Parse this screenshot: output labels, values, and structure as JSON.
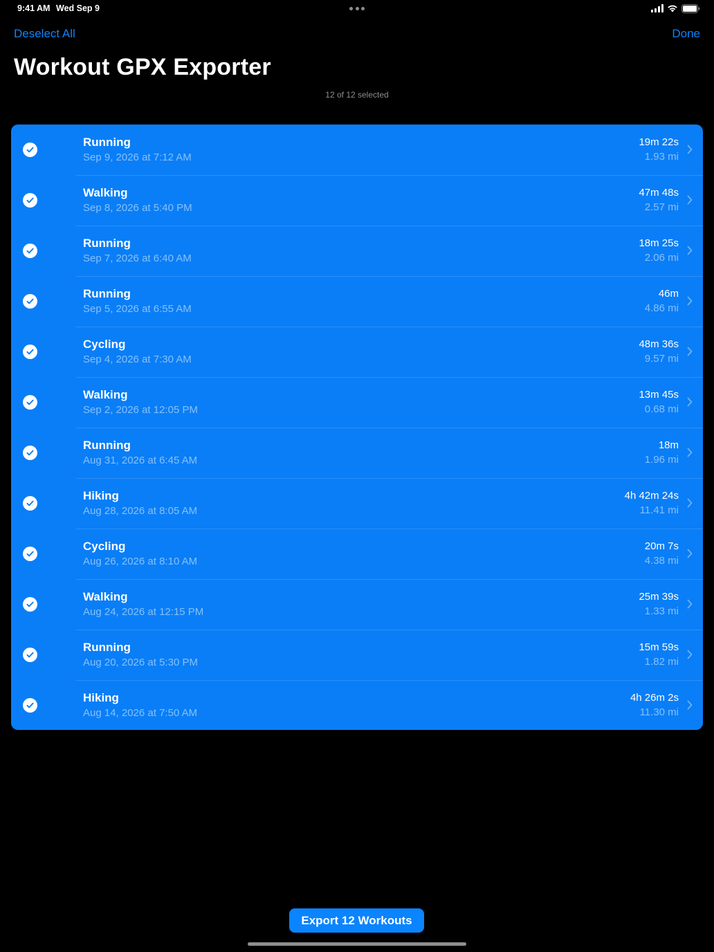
{
  "status_bar": {
    "time": "9:41 AM",
    "date": "Wed Sep 9"
  },
  "nav": {
    "deselect_label": "Deselect All",
    "done_label": "Done"
  },
  "title": "Workout GPX Exporter",
  "selection_count": "12 of 12 selected",
  "colors": {
    "accent": "#0a84ff",
    "selected_row": "#0a7ef7",
    "background": "#000000"
  },
  "workouts": [
    {
      "type": "Running",
      "date": "Sep 9, 2026 at 7:12 AM",
      "duration": "19m 22s",
      "distance": "1.93 mi",
      "selected": true
    },
    {
      "type": "Walking",
      "date": "Sep 8, 2026 at 5:40 PM",
      "duration": "47m 48s",
      "distance": "2.57 mi",
      "selected": true
    },
    {
      "type": "Running",
      "date": "Sep 7, 2026 at 6:40 AM",
      "duration": "18m 25s",
      "distance": "2.06 mi",
      "selected": true
    },
    {
      "type": "Running",
      "date": "Sep 5, 2026 at 6:55 AM",
      "duration": "46m",
      "distance": "4.86 mi",
      "selected": true
    },
    {
      "type": "Cycling",
      "date": "Sep 4, 2026 at 7:30 AM",
      "duration": "48m 36s",
      "distance": "9.57 mi",
      "selected": true
    },
    {
      "type": "Walking",
      "date": "Sep 2, 2026 at 12:05 PM",
      "duration": "13m 45s",
      "distance": "0.68 mi",
      "selected": true
    },
    {
      "type": "Running",
      "date": "Aug 31, 2026 at 6:45 AM",
      "duration": "18m",
      "distance": "1.96 mi",
      "selected": true
    },
    {
      "type": "Hiking",
      "date": "Aug 28, 2026 at 8:05 AM",
      "duration": "4h 42m 24s",
      "distance": "11.41 mi",
      "selected": true
    },
    {
      "type": "Cycling",
      "date": "Aug 26, 2026 at 8:10 AM",
      "duration": "20m 7s",
      "distance": "4.38 mi",
      "selected": true
    },
    {
      "type": "Walking",
      "date": "Aug 24, 2026 at 12:15 PM",
      "duration": "25m 39s",
      "distance": "1.33 mi",
      "selected": true
    },
    {
      "type": "Running",
      "date": "Aug 20, 2026 at 5:30 PM",
      "duration": "15m 59s",
      "distance": "1.82 mi",
      "selected": true
    },
    {
      "type": "Hiking",
      "date": "Aug 14, 2026 at 7:50 AM",
      "duration": "4h 26m 2s",
      "distance": "11.30 mi",
      "selected": true
    }
  ],
  "icons": {
    "check": "checkmark-circle-icon",
    "chevron": "chevron-right-icon"
  },
  "export_button_label": "Export 12 Workouts"
}
